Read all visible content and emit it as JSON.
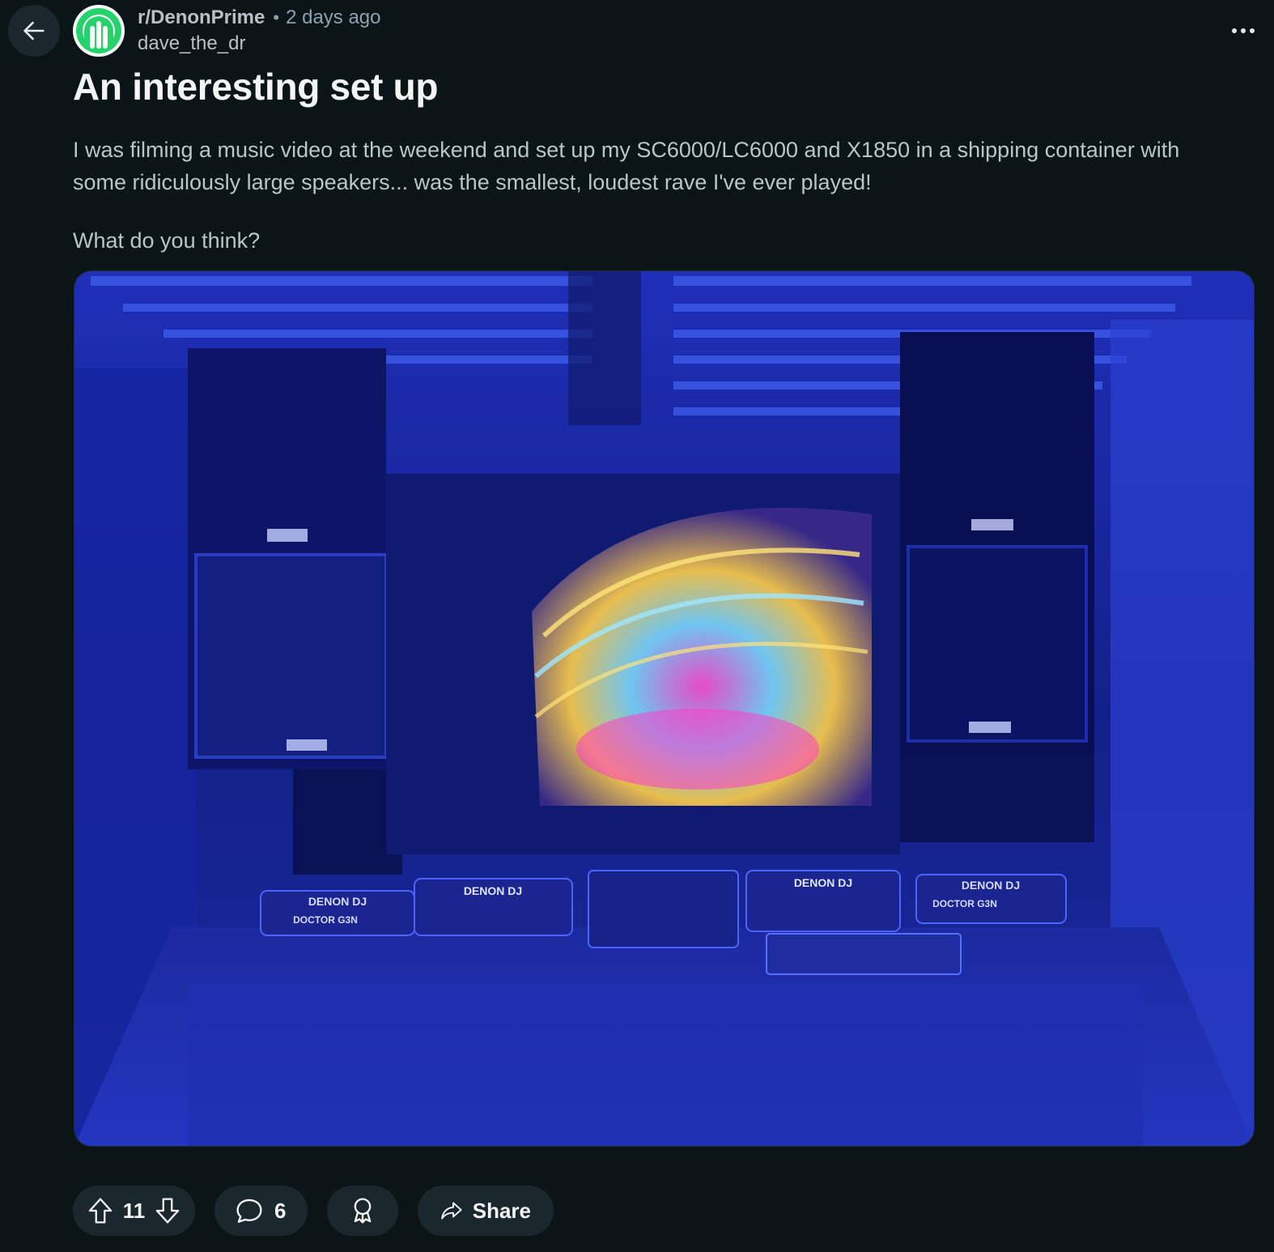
{
  "header": {
    "back_icon": "arrow-left-icon",
    "subreddit": "r/DenonPrime",
    "separator": "•",
    "time_ago": "2 days ago",
    "username": "dave_the_dr",
    "more_icon": "ellipsis-icon"
  },
  "post": {
    "title": "An interesting set up",
    "body_paragraph_1": "I was filming a music video at the weekend and set up my SC6000/LC6000 and X1850 in a shipping container with some ridiculously large speakers... was the smallest, loudest rave I've ever played!",
    "body_paragraph_2": "What do you think?",
    "image": {
      "description_labels": [
        "DENON DJ",
        "DOCTOR G3N"
      ]
    }
  },
  "actions": {
    "upvote_icon": "upvote-arrow-icon",
    "score": "11",
    "downvote_icon": "downvote-arrow-icon",
    "comment_icon": "speech-bubble-icon",
    "comment_count": "6",
    "award_icon": "award-ribbon-icon",
    "share_icon": "share-arrow-icon",
    "share_label": "Share"
  },
  "colors": {
    "background": "#0b1416",
    "pill_background": "#1a282d",
    "avatar_green": "#24d36b"
  }
}
